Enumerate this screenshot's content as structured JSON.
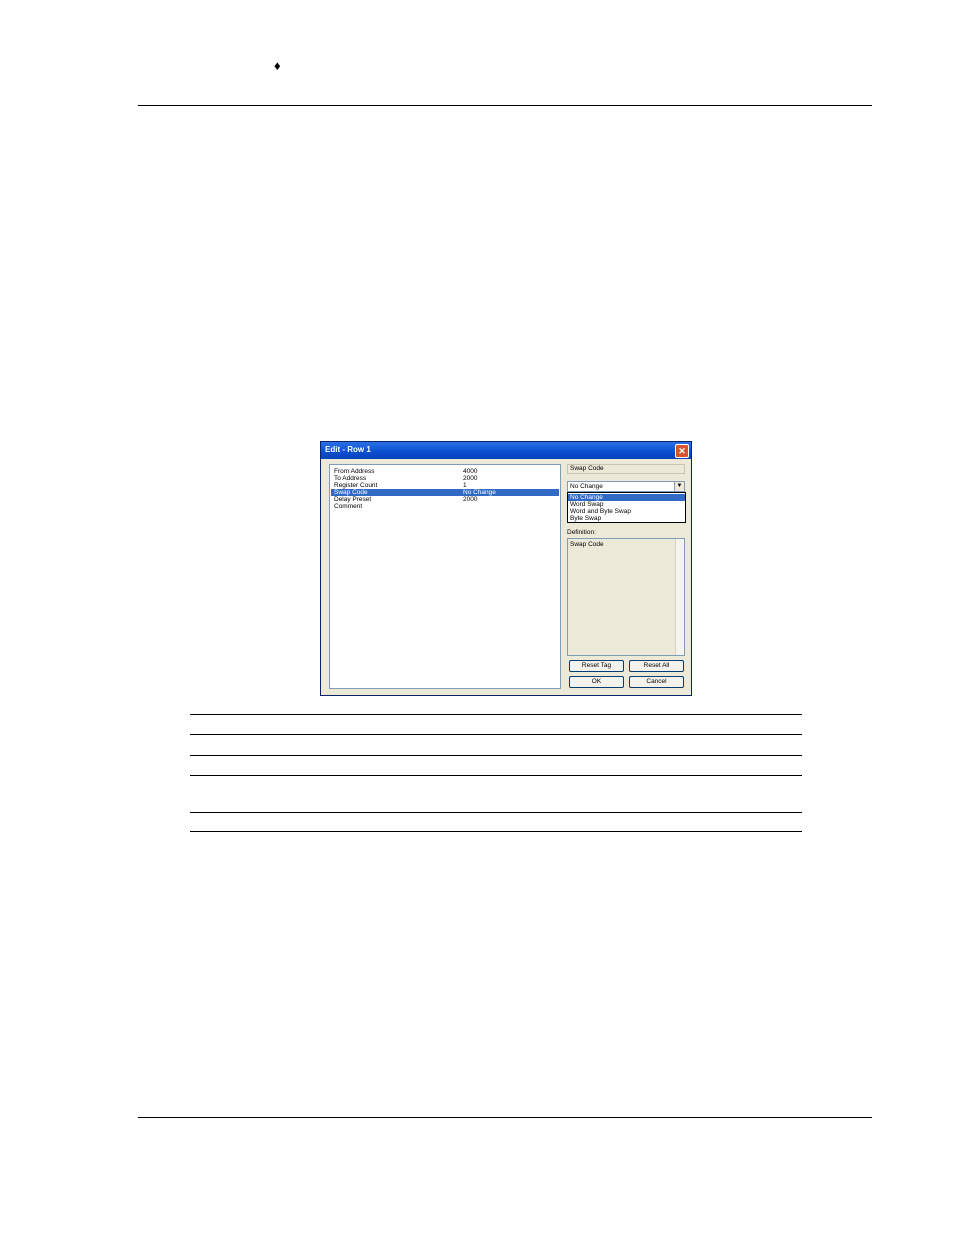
{
  "header": {
    "bullet": "♦"
  },
  "dialog": {
    "title": "Edit - Row 1",
    "close_glyph": "✕",
    "rows": [
      {
        "name": "From Address",
        "value": "4000",
        "selected": false
      },
      {
        "name": "To Address",
        "value": "2000",
        "selected": false
      },
      {
        "name": "Register Count",
        "value": "1",
        "selected": false
      },
      {
        "name": "Swap Code",
        "value": "No Change",
        "selected": true
      },
      {
        "name": "Delay Preset",
        "value": "2000",
        "selected": false
      },
      {
        "name": "Comment",
        "value": "",
        "selected": false
      }
    ],
    "field_label": "Swap Code",
    "combo_value": "No Change",
    "options": [
      "No Change",
      "Word Swap",
      "Word and Byte Swap",
      "Byte Swap"
    ],
    "selected_option": "No Change",
    "definition_label": "Definition:",
    "definition_text": "Swap Code",
    "buttons": {
      "reset_tag": "Reset Tag",
      "reset_all": "Reset All",
      "ok": "OK",
      "cancel": "Cancel"
    }
  },
  "colors": {
    "title_bar": "#0a4fd0",
    "selection": "#316ac5",
    "dialog_bg": "#ece9d8"
  }
}
